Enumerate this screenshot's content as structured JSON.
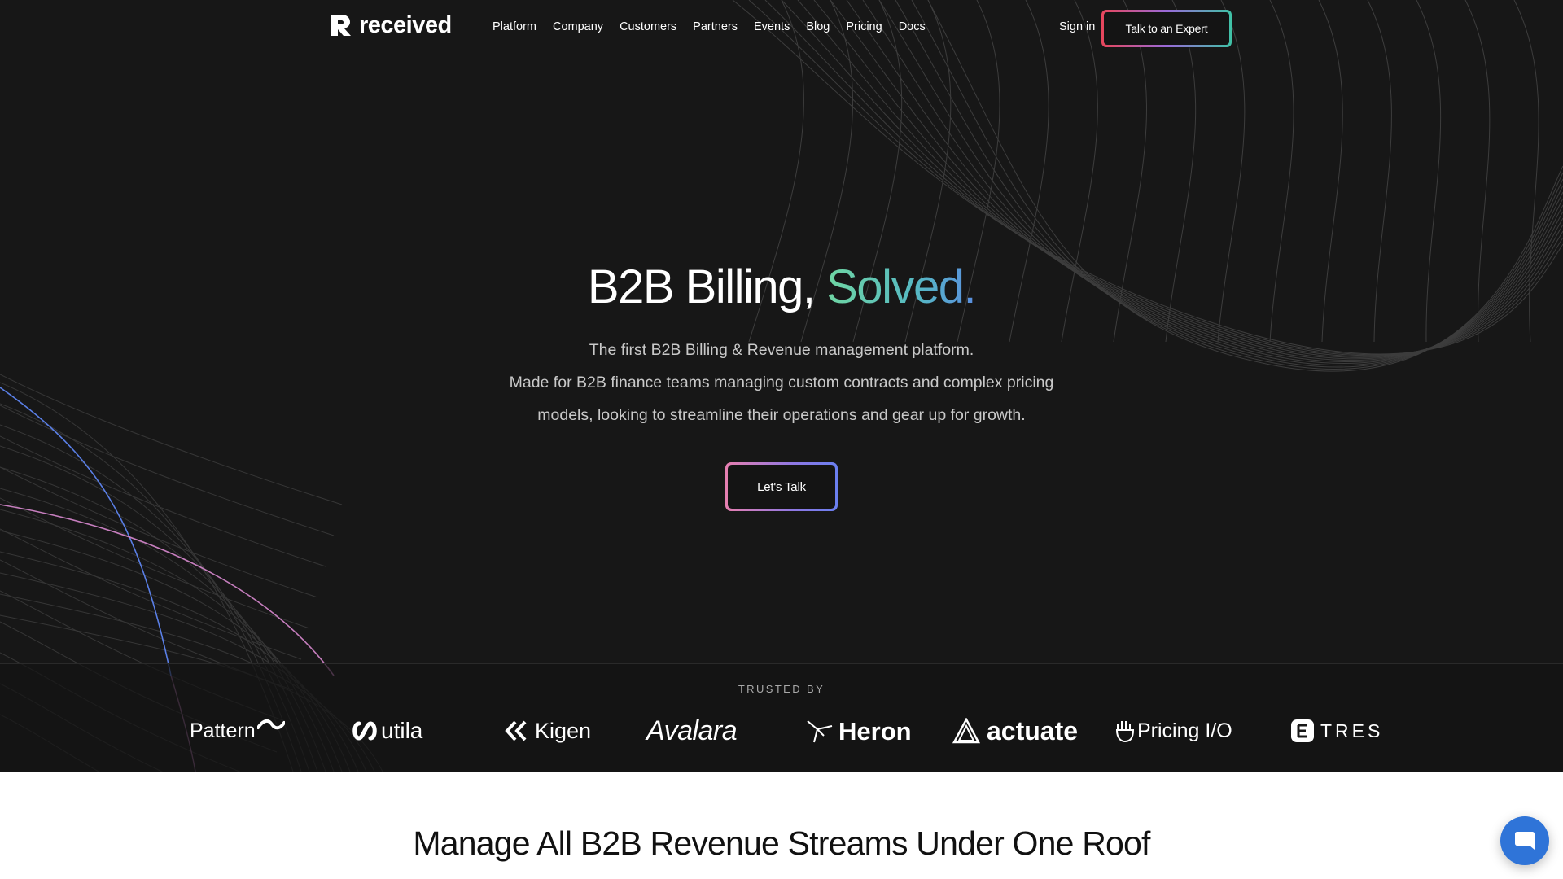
{
  "brand": {
    "name": "received"
  },
  "nav": {
    "links": [
      "Platform",
      "Company",
      "Customers",
      "Partners",
      "Events",
      "Blog",
      "Pricing",
      "Docs"
    ],
    "signin": "Sign in",
    "cta": "Talk to an Expert"
  },
  "hero": {
    "title_main": "B2B Billing,",
    "title_accent": "Solved.",
    "sub_line1": "The first B2B Billing & Revenue management platform.",
    "sub_line2": "Made for B2B finance teams managing custom contracts and complex pricing",
    "sub_line3": "models, looking to streamline their operations and gear up for growth.",
    "cta": "Let's Talk"
  },
  "trusted": {
    "label": "TRUSTED BY",
    "clients": [
      "Pattern",
      "utila",
      "Kigen",
      "Avalara",
      "Heron",
      "actuate",
      "Pricing I/O",
      "TRES"
    ]
  },
  "section": {
    "title": "Manage All B2B Revenue Streams Under One Roof"
  },
  "icons": {
    "logo": "received-logo-icon",
    "chat": "chat-bubble-icon"
  },
  "colors": {
    "background": "#171717",
    "accent_green": "#6fd6a3",
    "accent_blue": "#5a8fe0",
    "chat_blue": "#2f74d8"
  }
}
